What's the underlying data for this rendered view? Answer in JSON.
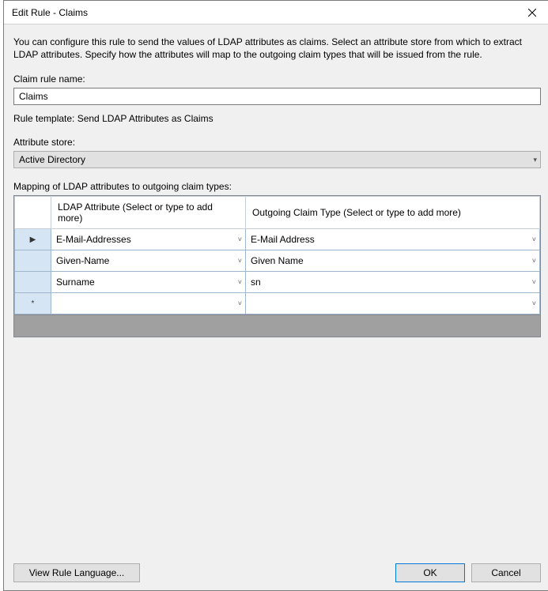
{
  "window": {
    "title": "Edit Rule - Claims"
  },
  "description": "You can configure this rule to send the values of LDAP attributes as claims. Select an attribute store from which to extract LDAP attributes. Specify how the attributes will map to the outgoing claim types that will be issued from the rule.",
  "claim_rule_name": {
    "label": "Claim rule name:",
    "value": "Claims"
  },
  "rule_template_line": "Rule template: Send LDAP Attributes as Claims",
  "attribute_store": {
    "label": "Attribute store:",
    "value": "Active Directory"
  },
  "mapping": {
    "label": "Mapping of LDAP attributes to outgoing claim types:",
    "columns": {
      "ldap": "LDAP Attribute (Select or type to add more)",
      "claim": "Outgoing Claim Type (Select or type to add more)"
    },
    "rows": [
      {
        "marker": "▶",
        "ldap": "E-Mail-Addresses",
        "claim": "E-Mail Address"
      },
      {
        "marker": "",
        "ldap": "Given-Name",
        "claim": "Given Name"
      },
      {
        "marker": "",
        "ldap": "Surname",
        "claim": "sn"
      },
      {
        "marker": "*",
        "ldap": "",
        "claim": ""
      }
    ]
  },
  "buttons": {
    "view_lang": "View Rule Language...",
    "ok": "OK",
    "cancel": "Cancel"
  }
}
